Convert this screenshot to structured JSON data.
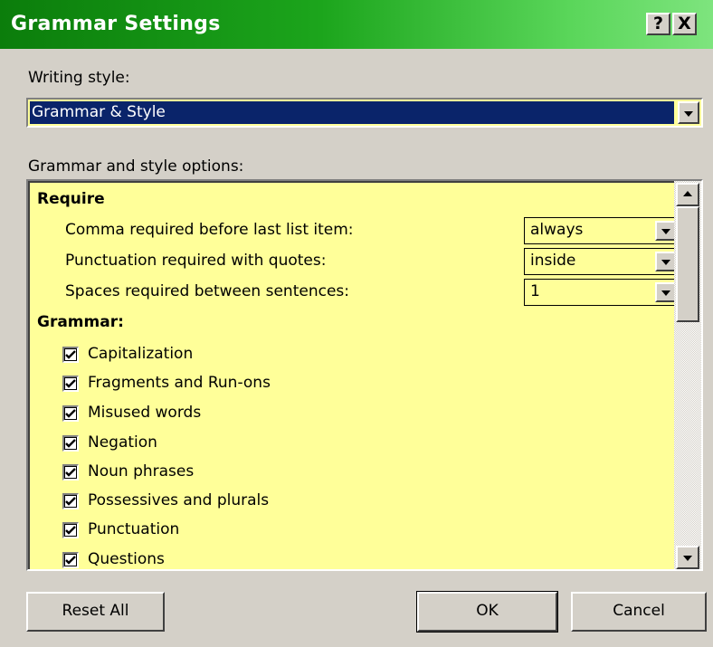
{
  "window": {
    "title": "Grammar Settings",
    "help_label": "?",
    "close_label": "X"
  },
  "writing_style": {
    "label": "Writing style:",
    "selected": "Grammar & Style"
  },
  "options": {
    "label": "Grammar and style options:",
    "require": {
      "heading": "Require",
      "rows": [
        {
          "label": "Comma required before last list item:",
          "value": "always"
        },
        {
          "label": "Punctuation required with quotes:",
          "value": "inside"
        },
        {
          "label": "Spaces required between sentences:",
          "value": "1"
        }
      ]
    },
    "grammar": {
      "heading": "Grammar:",
      "items": [
        {
          "label": "Capitalization",
          "checked": true
        },
        {
          "label": "Fragments and Run-ons",
          "checked": true
        },
        {
          "label": "Misused words",
          "checked": true
        },
        {
          "label": "Negation",
          "checked": true
        },
        {
          "label": "Noun phrases",
          "checked": true
        },
        {
          "label": "Possessives and plurals",
          "checked": true
        },
        {
          "label": "Punctuation",
          "checked": true
        },
        {
          "label": "Questions",
          "checked": true
        }
      ]
    }
  },
  "buttons": {
    "reset": "Reset All",
    "ok": "OK",
    "cancel": "Cancel"
  },
  "colors": {
    "title_gradient_start": "#0b7d0b",
    "title_gradient_end": "#7ee47e",
    "field_background": "#ffff99",
    "selection": "#0a246a",
    "dialog_face": "#d4d0c8"
  }
}
